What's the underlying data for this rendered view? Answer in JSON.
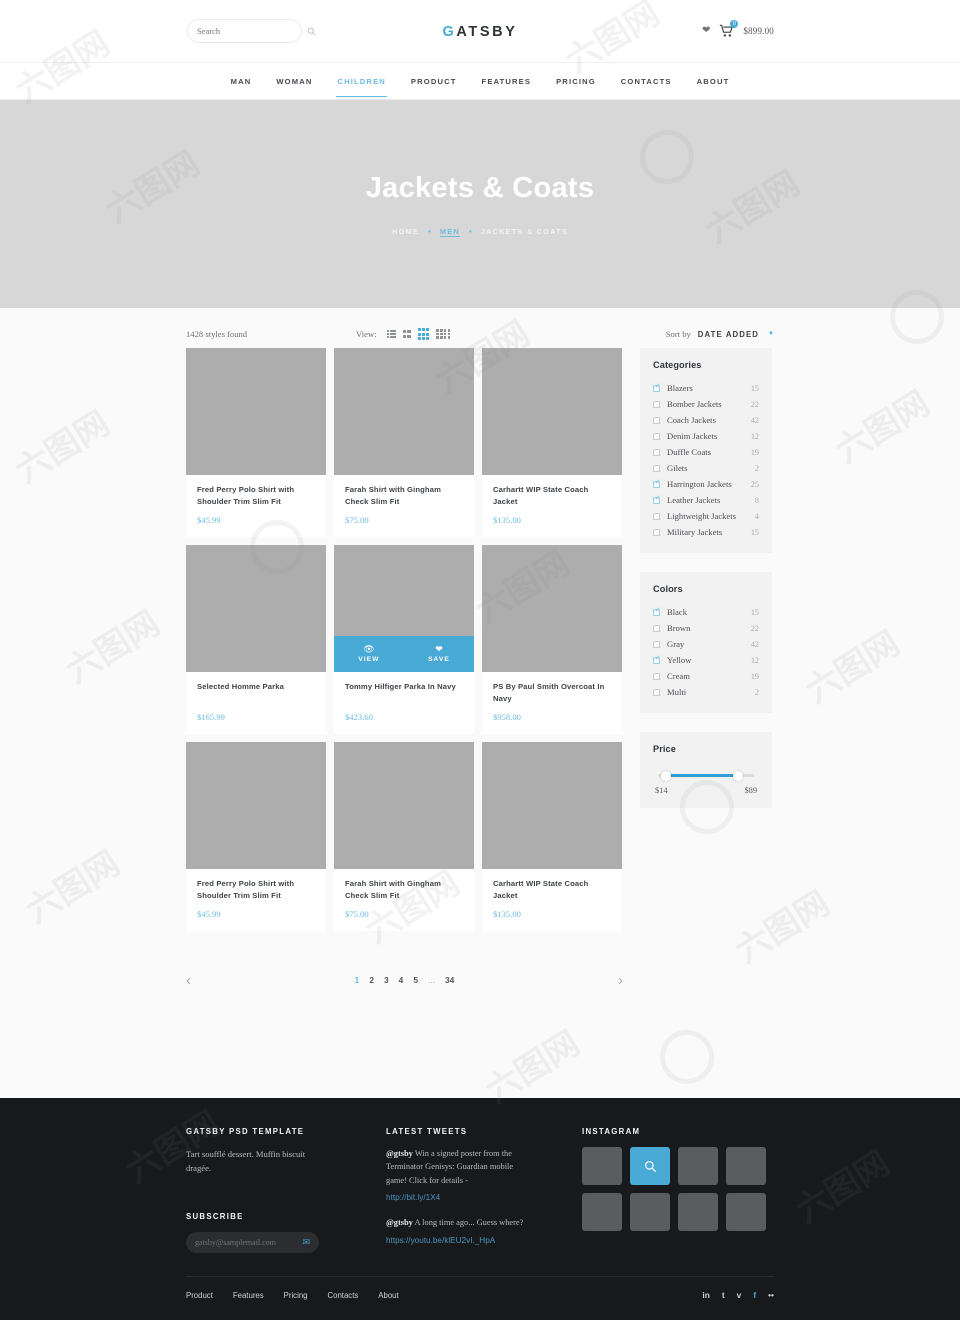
{
  "accent": "#4aaad6",
  "header": {
    "search": {
      "placeholder": "Search",
      "value": "",
      "icon": "search-icon"
    },
    "brand_g": "G",
    "brand_rest": "ATSBY",
    "wishlist_icon": "heart-icon",
    "cart_icon": "cart-icon",
    "cart_badge": "0",
    "cart_total": "$899.00"
  },
  "nav": {
    "items": [
      {
        "label": "MAN",
        "active": false
      },
      {
        "label": "WOMAN",
        "active": false
      },
      {
        "label": "CHILDREN",
        "active": true
      },
      {
        "label": "PRODUCT",
        "active": false
      },
      {
        "label": "FEATURES",
        "active": false
      },
      {
        "label": "PRICING",
        "active": false
      },
      {
        "label": "CONTACTS",
        "active": false
      },
      {
        "label": "ABOUT",
        "active": false
      }
    ]
  },
  "hero": {
    "title": "Jackets & Coats",
    "breadcrumb": [
      "HOME",
      "MEN",
      "JACKETS & COATS"
    ],
    "breadcrumb_current_index": 1,
    "separator": "•"
  },
  "toolbar": {
    "styles_found": "1428 styles found",
    "view_label": "View:",
    "view_modes": [
      {
        "name": "list-view",
        "active": false
      },
      {
        "name": "grid-2-view",
        "active": false
      },
      {
        "name": "grid-3-view",
        "active": true
      },
      {
        "name": "grid-4-view",
        "active": false
      }
    ],
    "sort_label": "Sort by",
    "sort_value": "DATE ADDED",
    "sort_caret": "▼"
  },
  "products": [
    {
      "name": "Fred Perry Polo Shirt with Shoulder Trim Slim Fit",
      "price": "$45.99",
      "hover": false
    },
    {
      "name": "Farah Shirt with Gingham Check Slim Fit",
      "price": "$75.00",
      "hover": false
    },
    {
      "name": "Carhartt WIP State Coach Jacket",
      "price": "$135.00",
      "hover": false
    },
    {
      "name": "Selected Homme Parka",
      "price": "$165.99",
      "hover": false
    },
    {
      "name": "Tommy Hilfiger Parka In Navy",
      "price": "$423.60",
      "hover": true
    },
    {
      "name": "PS By Paul Smith Overcoat In Navy",
      "price": "$958.00",
      "hover": false
    },
    {
      "name": "Fred Perry Polo Shirt with Shoulder Trim Slim Fit",
      "price": "$45.99",
      "hover": false
    },
    {
      "name": "Farah Shirt with Gingham Check Slim Fit",
      "price": "$75.00",
      "hover": false
    },
    {
      "name": "Carhartt WIP State Coach Jacket",
      "price": "$135.00",
      "hover": false
    }
  ],
  "hover_actions": {
    "view_label": "VIEW",
    "view_icon": "eye-icon",
    "save_label": "SAVE",
    "save_icon": "heart-icon"
  },
  "pagination": {
    "prev_icon": "chevron-left-icon",
    "next_icon": "chevron-right-icon",
    "pages": [
      "1",
      "2",
      "3",
      "4",
      "5",
      "...",
      "34"
    ],
    "active": "1"
  },
  "sidebar": {
    "categories": {
      "title": "Categories",
      "items": [
        {
          "label": "Blazers",
          "count": "15",
          "checked": true
        },
        {
          "label": "Bomber Jackets",
          "count": "22",
          "checked": false
        },
        {
          "label": "Coach Jackets",
          "count": "42",
          "checked": false
        },
        {
          "label": "Denim Jackets",
          "count": "12",
          "checked": false
        },
        {
          "label": "Duffle Coats",
          "count": "19",
          "checked": false
        },
        {
          "label": "Gilets",
          "count": "2",
          "checked": false
        },
        {
          "label": "Harrington Jackets",
          "count": "25",
          "checked": true
        },
        {
          "label": "Leather Jackets",
          "count": "8",
          "checked": true
        },
        {
          "label": "Lightweight Jackets",
          "count": "4",
          "checked": false
        },
        {
          "label": "Military Jackets",
          "count": "15",
          "checked": false
        }
      ]
    },
    "colors": {
      "title": "Colors",
      "items": [
        {
          "label": "Black",
          "count": "15",
          "checked": true
        },
        {
          "label": "Brown",
          "count": "22",
          "checked": false
        },
        {
          "label": "Gray",
          "count": "42",
          "checked": false
        },
        {
          "label": "Yellow",
          "count": "12",
          "checked": true
        },
        {
          "label": "Cream",
          "count": "19",
          "checked": false
        },
        {
          "label": "Multi",
          "count": "2",
          "checked": false
        }
      ]
    },
    "price": {
      "title": "Price",
      "min": "$14",
      "max": "$89"
    }
  },
  "footer": {
    "about": {
      "title": "GATSBY PSD TEMPLATE",
      "text": "Tart soufflé dessert. Muffin biscuit dragée."
    },
    "subscribe": {
      "title": "SUBSCRIBE",
      "value": "gatsby@samplemail.com",
      "placeholder": "gatsby@samplemail.com",
      "icon": "envelope-icon"
    },
    "tweets": {
      "title": "LATEST TWEETS",
      "items": [
        {
          "handle": "@gtsby",
          "text": " Win a signed poster from the Terminator Genisys: Guardian mobile game! Click for details -",
          "link": "http://bit.ly/1X4"
        },
        {
          "handle": "@gtsby",
          "text": " A long time ago... Guess where?",
          "link": "https://youtu.be/klEU2vI._HpA"
        }
      ]
    },
    "instagram": {
      "title": "INSTAGRAM",
      "cells": [
        {
          "highlight": false
        },
        {
          "highlight": true,
          "icon": "search-icon"
        },
        {
          "highlight": false
        },
        {
          "highlight": false
        },
        {
          "highlight": false
        },
        {
          "highlight": false
        },
        {
          "highlight": false
        },
        {
          "highlight": false
        }
      ]
    },
    "links": [
      "Product",
      "Features",
      "Pricing",
      "Contacts",
      "About"
    ],
    "social": [
      {
        "glyph": "in",
        "name": "linkedin-icon",
        "brand": false
      },
      {
        "glyph": "t",
        "name": "twitter-icon",
        "brand": false
      },
      {
        "glyph": "v",
        "name": "vimeo-icon",
        "brand": false
      },
      {
        "glyph": "f",
        "name": "facebook-icon",
        "brand": true
      },
      {
        "glyph": "••",
        "name": "flickr-icon",
        "brand": false
      }
    ]
  }
}
